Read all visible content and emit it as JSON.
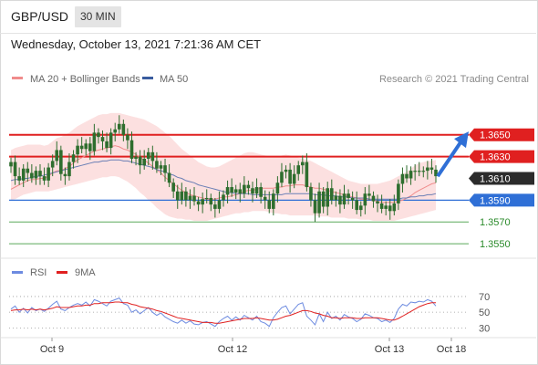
{
  "header": {
    "symbol": "GBP/USD",
    "timeframe": "30 MIN",
    "datetime": "Wednesday, October 13, 2021 7:21:36 AM CET"
  },
  "legend": {
    "ma20": "MA 20 + Bollinger Bands",
    "ma50": "MA 50",
    "copyright": "Research © 2021 Trading Central",
    "rsi": "RSI",
    "ma9": "9MA"
  },
  "colors": {
    "resistance": "#e02020",
    "support": "#2f6fd6",
    "band_fill": "#fbd5d5",
    "ma20": "#f08c8c",
    "ma50": "#6a7fb5",
    "candle": "#2e6e2e",
    "arrow": "#2f6fd6",
    "rsi": "#6d8be0",
    "ma9": "#e02020"
  },
  "chart_data": [
    {
      "type": "candlestick",
      "title": "GBP/USD",
      "x_labels": [
        "Oct 9",
        "Oct 12",
        "Oct 13",
        "Oct 18"
      ],
      "ylim": [
        1.3535,
        1.369
      ],
      "levels": [
        {
          "label": "1.3650",
          "value": 1.365,
          "kind": "resistance"
        },
        {
          "label": "1.3630",
          "value": 1.363,
          "kind": "resistance"
        },
        {
          "label": "1.3610",
          "value": 1.361,
          "kind": "current"
        },
        {
          "label": "1.3590",
          "value": 1.359,
          "kind": "support"
        },
        {
          "label": "1.3570",
          "value": 1.357,
          "kind": "target"
        },
        {
          "label": "1.3550",
          "value": 1.355,
          "kind": "target"
        }
      ],
      "arrow": {
        "from": 1.3612,
        "to": 1.3648
      },
      "close": [
        1.3625,
        1.3612,
        1.3608,
        1.3619,
        1.3615,
        1.361,
        1.3617,
        1.3612,
        1.3608,
        1.362,
        1.3626,
        1.3636,
        1.3614,
        1.3612,
        1.3625,
        1.3632,
        1.364,
        1.3637,
        1.3642,
        1.3635,
        1.3652,
        1.3648,
        1.3644,
        1.3638,
        1.3652,
        1.3655,
        1.366,
        1.365,
        1.3645,
        1.3628,
        1.363,
        1.3622,
        1.3628,
        1.3634,
        1.3626,
        1.3619,
        1.3622,
        1.3615,
        1.3606,
        1.3598,
        1.359,
        1.3598,
        1.359,
        1.3594,
        1.3589,
        1.3586,
        1.3591,
        1.3592,
        1.3586,
        1.3582,
        1.359,
        1.3595,
        1.3602,
        1.3597,
        1.36,
        1.3596,
        1.3604,
        1.3601,
        1.3596,
        1.3602,
        1.3593,
        1.359,
        1.3582,
        1.3596,
        1.3606,
        1.3616,
        1.3618,
        1.3605,
        1.3614,
        1.3622,
        1.3625,
        1.3602,
        1.359,
        1.3578,
        1.3598,
        1.3584,
        1.3601,
        1.359,
        1.3594,
        1.3586,
        1.3596,
        1.3592,
        1.359,
        1.3581,
        1.3585,
        1.3596,
        1.3594,
        1.3589,
        1.3587,
        1.3582,
        1.3585,
        1.358,
        1.3587,
        1.3605,
        1.3614,
        1.361,
        1.3617,
        1.3616,
        1.3617,
        1.3617,
        1.362,
        1.3618,
        1.3612
      ],
      "ma20": [
        1.36,
        1.3602,
        1.3604,
        1.3606,
        1.3608,
        1.3609,
        1.3609,
        1.361,
        1.361,
        1.3612,
        1.3615,
        1.3617,
        1.3617,
        1.3619,
        1.3621,
        1.3624,
        1.3627,
        1.3629,
        1.3631,
        1.3633,
        1.3635,
        1.3636,
        1.3637,
        1.3638,
        1.3639,
        1.364,
        1.3639,
        1.3637,
        1.3636,
        1.3634,
        1.3632,
        1.3629,
        1.3627,
        1.3624,
        1.3621,
        1.3618,
        1.3615,
        1.3611,
        1.3608,
        1.3605,
        1.3602,
        1.3599,
        1.3597,
        1.3595,
        1.3594,
        1.3593,
        1.3592,
        1.3591,
        1.3591,
        1.3591,
        1.3592,
        1.3593,
        1.3593,
        1.3594,
        1.3595,
        1.3596,
        1.3598,
        1.3599,
        1.3599,
        1.36,
        1.3601,
        1.3601,
        1.3601,
        1.3601,
        1.3602,
        1.3602,
        1.3603,
        1.3603,
        1.3604,
        1.3604,
        1.3604,
        1.3603,
        1.3602,
        1.3601,
        1.3601,
        1.36,
        1.3599,
        1.3598,
        1.3597,
        1.3596,
        1.3595,
        1.3594,
        1.3593,
        1.3592,
        1.3591,
        1.3591,
        1.3591,
        1.359,
        1.3589,
        1.3588,
        1.3588,
        1.3588,
        1.3588,
        1.3589,
        1.359,
        1.3592,
        1.3594,
        1.3597,
        1.3599,
        1.3601,
        1.3603,
        1.3605,
        1.3606
      ],
      "ma50": [
        1.3608,
        1.3609,
        1.3609,
        1.361,
        1.361,
        1.3611,
        1.3612,
        1.3612,
        1.3613,
        1.3614,
        1.3615,
        1.3616,
        1.3617,
        1.3618,
        1.3619,
        1.362,
        1.3621,
        1.3622,
        1.3623,
        1.3624,
        1.3625,
        1.3625,
        1.3626,
        1.3626,
        1.3627,
        1.3627,
        1.3627,
        1.3626,
        1.3626,
        1.3625,
        1.3624,
        1.3623,
        1.3622,
        1.3621,
        1.362,
        1.3618,
        1.3617,
        1.3616,
        1.3614,
        1.3613,
        1.3611,
        1.361,
        1.3608,
        1.3607,
        1.3606,
        1.3604,
        1.3603,
        1.3602,
        1.3601,
        1.36,
        1.3599,
        1.3598,
        1.3597,
        1.3597,
        1.3596,
        1.3596,
        1.3596,
        1.3596,
        1.3595,
        1.3595,
        1.3595,
        1.3595,
        1.3595,
        1.3595,
        1.3595,
        1.3595,
        1.3596,
        1.3596,
        1.3596,
        1.3596,
        1.3596,
        1.3596,
        1.3596,
        1.3595,
        1.3595,
        1.3595,
        1.3594,
        1.3594,
        1.3594,
        1.3593,
        1.3593,
        1.3593,
        1.3592,
        1.3592,
        1.3592,
        1.3592,
        1.3591,
        1.3591,
        1.3591,
        1.3591,
        1.3591,
        1.3591,
        1.3591,
        1.3591,
        1.3592,
        1.3592,
        1.3593,
        1.3593,
        1.3594,
        1.3594,
        1.3595,
        1.3595,
        1.3596
      ],
      "band_upper": [
        1.3636,
        1.3638,
        1.3639,
        1.364,
        1.3641,
        1.3641,
        1.3641,
        1.3641,
        1.364,
        1.3641,
        1.3644,
        1.3647,
        1.3648,
        1.365,
        1.3652,
        1.3655,
        1.3658,
        1.366,
        1.3662,
        1.3664,
        1.3666,
        1.3668,
        1.3669,
        1.3669,
        1.367,
        1.367,
        1.367,
        1.3669,
        1.3668,
        1.3667,
        1.3666,
        1.3665,
        1.3664,
        1.3662,
        1.366,
        1.3658,
        1.3655,
        1.3652,
        1.3649,
        1.3645,
        1.3641,
        1.3637,
        1.3634,
        1.3631,
        1.3628,
        1.3625,
        1.3623,
        1.3621,
        1.362,
        1.362,
        1.3621,
        1.3623,
        1.3625,
        1.3627,
        1.3629,
        1.3631,
        1.3633,
        1.3634,
        1.3634,
        1.3633,
        1.3632,
        1.3631,
        1.363,
        1.363,
        1.363,
        1.3631,
        1.3632,
        1.3631,
        1.363,
        1.3629,
        1.3628,
        1.3627,
        1.3626,
        1.3624,
        1.3622,
        1.362,
        1.3618,
        1.3616,
        1.3614,
        1.3612,
        1.361,
        1.3608,
        1.3607,
        1.3606,
        1.3605,
        1.3605,
        1.3605,
        1.3605,
        1.3605,
        1.3606,
        1.3607,
        1.3608,
        1.361,
        1.3612,
        1.3614,
        1.3616,
        1.3619,
        1.3622,
        1.3624,
        1.3625,
        1.3626,
        1.3626,
        1.3627
      ],
      "band_lower": [
        1.359,
        1.3591,
        1.3593,
        1.3595,
        1.3596,
        1.3597,
        1.3598,
        1.3598,
        1.3598,
        1.3598,
        1.3599,
        1.36,
        1.3601,
        1.3602,
        1.3603,
        1.3604,
        1.3605,
        1.3606,
        1.3607,
        1.3608,
        1.3609,
        1.361,
        1.3611,
        1.3611,
        1.3612,
        1.3612,
        1.3611,
        1.3609,
        1.3607,
        1.3604,
        1.3601,
        1.3597,
        1.3594,
        1.359,
        1.3587,
        1.3583,
        1.358,
        1.3577,
        1.3575,
        1.3574,
        1.3573,
        1.3573,
        1.3572,
        1.3572,
        1.3571,
        1.3571,
        1.3571,
        1.3571,
        1.3572,
        1.3573,
        1.3574,
        1.3575,
        1.3576,
        1.3577,
        1.3578,
        1.3578,
        1.3579,
        1.3579,
        1.358,
        1.358,
        1.358,
        1.358,
        1.3579,
        1.3578,
        1.3578,
        1.3577,
        1.3577,
        1.3576,
        1.3576,
        1.3576,
        1.3576,
        1.3576,
        1.3576,
        1.3576,
        1.3575,
        1.3575,
        1.3575,
        1.3574,
        1.3574,
        1.3574,
        1.3574,
        1.3573,
        1.3573,
        1.3573,
        1.3572,
        1.3572,
        1.3572,
        1.3571,
        1.3571,
        1.3571,
        1.3571,
        1.3571,
        1.3571,
        1.3572,
        1.3573,
        1.3574,
        1.3575,
        1.3576,
        1.3577,
        1.3578,
        1.3579,
        1.358,
        1.3581
      ]
    },
    {
      "type": "line",
      "title": "RSI",
      "ylim": [
        20,
        85
      ],
      "y_ticks": [
        70,
        50,
        30
      ],
      "series": [
        {
          "name": "RSI",
          "values": [
            54,
            58,
            50,
            55,
            49,
            56,
            52,
            54,
            51,
            55,
            60,
            64,
            54,
            52,
            56,
            59,
            61,
            59,
            63,
            58,
            66,
            64,
            61,
            58,
            64,
            66,
            68,
            61,
            59,
            50,
            53,
            48,
            52,
            56,
            50,
            46,
            49,
            44,
            41,
            38,
            36,
            40,
            36,
            39,
            35,
            34,
            37,
            38,
            35,
            32,
            38,
            42,
            45,
            40,
            44,
            40,
            46,
            43,
            40,
            45,
            38,
            36,
            32,
            43,
            50,
            56,
            58,
            48,
            54,
            60,
            62,
            45,
            40,
            34,
            48,
            38,
            50,
            42,
            45,
            40,
            47,
            44,
            42,
            38,
            41,
            48,
            46,
            43,
            42,
            38,
            40,
            37,
            42,
            54,
            60,
            58,
            63,
            62,
            64,
            63,
            66,
            64,
            58
          ]
        },
        {
          "name": "9MA",
          "values": [
            52,
            53,
            53,
            54,
            53,
            54,
            53,
            54,
            53,
            54,
            55,
            57,
            56,
            56,
            56,
            57,
            58,
            58,
            59,
            59,
            61,
            61,
            62,
            62,
            62,
            63,
            63,
            62,
            62,
            60,
            59,
            57,
            56,
            55,
            54,
            52,
            51,
            49,
            47,
            45,
            43,
            42,
            41,
            40,
            39,
            38,
            37,
            37,
            37,
            36,
            36,
            37,
            38,
            39,
            40,
            41,
            42,
            42,
            42,
            43,
            42,
            41,
            40,
            40,
            41,
            43,
            45,
            46,
            48,
            50,
            52,
            52,
            51,
            49,
            48,
            46,
            45,
            43,
            43,
            42,
            43,
            43,
            43,
            42,
            42,
            43,
            43,
            43,
            43,
            42,
            41,
            40,
            40,
            42,
            45,
            48,
            51,
            54,
            57,
            59,
            61,
            62,
            62
          ]
        }
      ]
    }
  ]
}
